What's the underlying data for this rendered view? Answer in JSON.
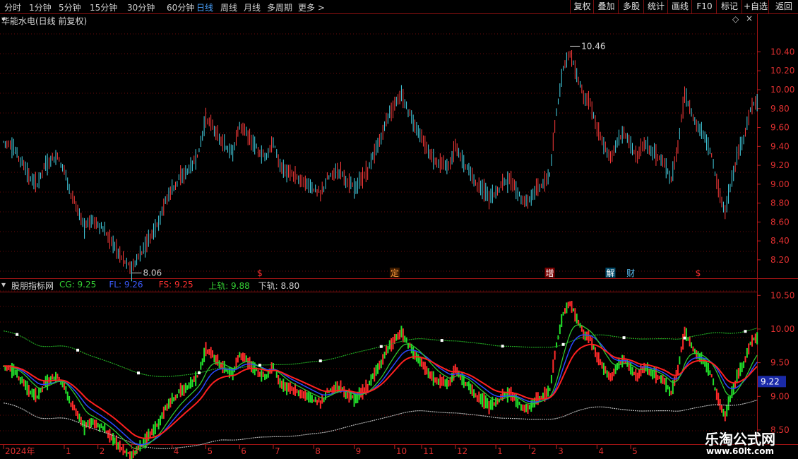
{
  "toolbar": {
    "left": [
      {
        "label": "分时",
        "active": false
      },
      {
        "label": "1分钟",
        "active": false
      },
      {
        "label": "5分钟",
        "active": false
      },
      {
        "label": "15分钟",
        "active": false
      },
      {
        "label": "30分钟",
        "active": false
      },
      {
        "label": "60分钟",
        "active": false
      },
      {
        "label": "日线",
        "active": true
      },
      {
        "label": "周线",
        "active": false
      },
      {
        "label": "月线",
        "active": false
      },
      {
        "label": "多周期",
        "active": false
      },
      {
        "label": "更多 >",
        "active": false
      }
    ],
    "right": [
      "复权",
      "叠加",
      "多股",
      "统计",
      "画线",
      "F10",
      "标记",
      "+自选",
      "返回"
    ]
  },
  "main_panel": {
    "title": "华能水电(日线 前复权)",
    "icon_collapse": "chevron-down-icon",
    "icon_diamond": "diamond-icon",
    "icon_close": "close-icon",
    "high_label": "10.46",
    "low_label": "8.06",
    "event_markers": [
      {
        "label": "$",
        "color": "#ff3030",
        "bg": "",
        "bar": 38
      },
      {
        "label": "定",
        "color": "#ff9a3a",
        "bg": "#3a1a00",
        "bar": 58
      },
      {
        "label": "增",
        "color": "#ffffff",
        "bg": "#7a0000",
        "bar": 81
      },
      {
        "label": "解",
        "color": "#ffffff",
        "bg": "#004a6a",
        "bar": 90
      },
      {
        "label": "财",
        "color": "#5fc8ff",
        "bg": "",
        "bar": 93
      },
      {
        "label": "$",
        "color": "#ff3030",
        "bg": "",
        "bar": 103
      }
    ]
  },
  "indicator_panel": {
    "name": "股朋指标网",
    "fields": [
      {
        "key": "CG",
        "value": "9.25",
        "color": "#34d134"
      },
      {
        "key": "FL",
        "value": "9.26",
        "color": "#3b5bff"
      },
      {
        "key": "FS",
        "value": "9.25",
        "color": "#ff3030"
      },
      {
        "key": "上轨",
        "value": "9.88",
        "color": "#34d134"
      },
      {
        "key": "下轨",
        "value": "8.80",
        "color": "#d0d0d0"
      }
    ],
    "current_value": "9.22"
  },
  "watermark": {
    "title": "乐淘公式网",
    "url": "www.60lt.com"
  },
  "chart_data": {
    "type": "candlestick",
    "x_start_label": "2024年",
    "month_labels": [
      {
        "label": "2024年",
        "bar": 0
      },
      {
        "label": "1",
        "bar": 9
      },
      {
        "label": "2",
        "bar": 14
      },
      {
        "label": "3",
        "bar": 19
      },
      {
        "label": "4",
        "bar": 25
      },
      {
        "label": "5",
        "bar": 30
      },
      {
        "label": "6",
        "bar": 35
      },
      {
        "label": "7",
        "bar": 40
      },
      {
        "label": "8",
        "bar": 46
      },
      {
        "label": "9",
        "bar": 52
      },
      {
        "label": "10",
        "bar": 58
      },
      {
        "label": "11",
        "bar": 62
      },
      {
        "label": "12",
        "bar": 67
      },
      {
        "label": "1",
        "bar": 73
      },
      {
        "label": "2",
        "bar": 78
      },
      {
        "label": "3",
        "bar": 82
      },
      {
        "label": "4",
        "bar": 88
      },
      {
        "label": "5",
        "bar": 93
      }
    ],
    "main_axis": {
      "ticks": [
        8.2,
        8.4,
        8.6,
        8.8,
        9.0,
        9.2,
        9.4,
        9.6,
        9.8,
        10.0,
        10.2,
        10.4
      ],
      "ylim": [
        8.02,
        10.68
      ]
    },
    "indicator_axis": {
      "ticks": [
        8.5,
        9.0,
        9.5,
        10.0,
        10.5
      ],
      "ylim": [
        8.3,
        10.65
      ]
    },
    "close": [
      9.45,
      9.42,
      9.32,
      9.2,
      9.05,
      9.0,
      9.18,
      9.25,
      9.3,
      9.15,
      8.9,
      8.72,
      8.55,
      8.62,
      8.58,
      8.5,
      8.4,
      8.28,
      8.18,
      8.1,
      8.22,
      8.35,
      8.48,
      8.6,
      8.82,
      8.95,
      9.05,
      9.12,
      9.2,
      9.35,
      9.7,
      9.62,
      9.48,
      9.38,
      9.35,
      9.62,
      9.55,
      9.42,
      9.35,
      9.28,
      9.45,
      9.2,
      9.12,
      9.1,
      9.05,
      9.0,
      8.95,
      8.9,
      9.05,
      9.12,
      9.15,
      9.02,
      8.95,
      9.05,
      9.15,
      9.32,
      9.5,
      9.72,
      9.85,
      9.95,
      9.78,
      9.62,
      9.48,
      9.35,
      9.25,
      9.22,
      9.18,
      9.4,
      9.25,
      9.15,
      9.02,
      8.95,
      8.85,
      8.9,
      9.02,
      9.05,
      8.95,
      8.82,
      8.85,
      8.95,
      9.0,
      9.1,
      9.75,
      10.25,
      10.4,
      10.15,
      9.95,
      9.85,
      9.6,
      9.4,
      9.28,
      9.45,
      9.55,
      9.4,
      9.3,
      9.45,
      9.35,
      9.3,
      9.2,
      9.05,
      9.4,
      9.95,
      9.75,
      9.6,
      9.5,
      9.3,
      8.95,
      8.7,
      9.05,
      9.35,
      9.55,
      9.85
    ],
    "series": [
      {
        "name": "CG",
        "color": "#2ec82e",
        "kind": "fast"
      },
      {
        "name": "FL",
        "color": "#2b48ff",
        "kind": "mid"
      },
      {
        "name": "FS",
        "color": "#ff2020",
        "kind": "slow"
      },
      {
        "name": "上轨",
        "color": "#22a822",
        "kind": "upper"
      },
      {
        "name": "下轨",
        "color": "#b8b8b8",
        "kind": "lower"
      }
    ]
  }
}
